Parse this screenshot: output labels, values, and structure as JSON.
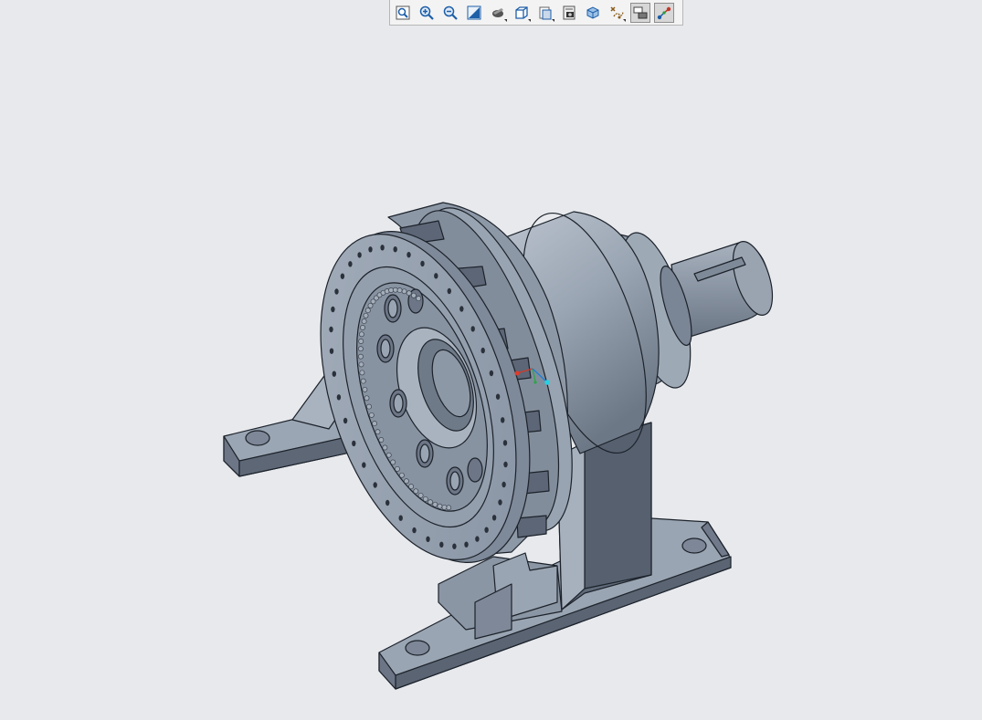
{
  "toolbar": {
    "buttons": [
      {
        "icon": "refit-icon",
        "active": false
      },
      {
        "icon": "zoom-in-icon",
        "active": false
      },
      {
        "icon": "zoom-out-icon",
        "active": false
      },
      {
        "icon": "repaint-icon",
        "active": false
      },
      {
        "icon": "perspective-icon",
        "active": false
      },
      {
        "icon": "display-style-icon",
        "active": false
      },
      {
        "icon": "saved-orientations-icon",
        "active": false
      },
      {
        "icon": "view-manager-icon",
        "active": false
      },
      {
        "icon": "section-icon",
        "active": false
      },
      {
        "icon": "datum-display-icon",
        "active": false
      },
      {
        "icon": "annotation-display-icon",
        "active": true
      },
      {
        "icon": "spin-center-icon",
        "active": true
      }
    ]
  },
  "viewport": {
    "background_color": "#e7e9ed",
    "model_color": "#8c98a8"
  }
}
